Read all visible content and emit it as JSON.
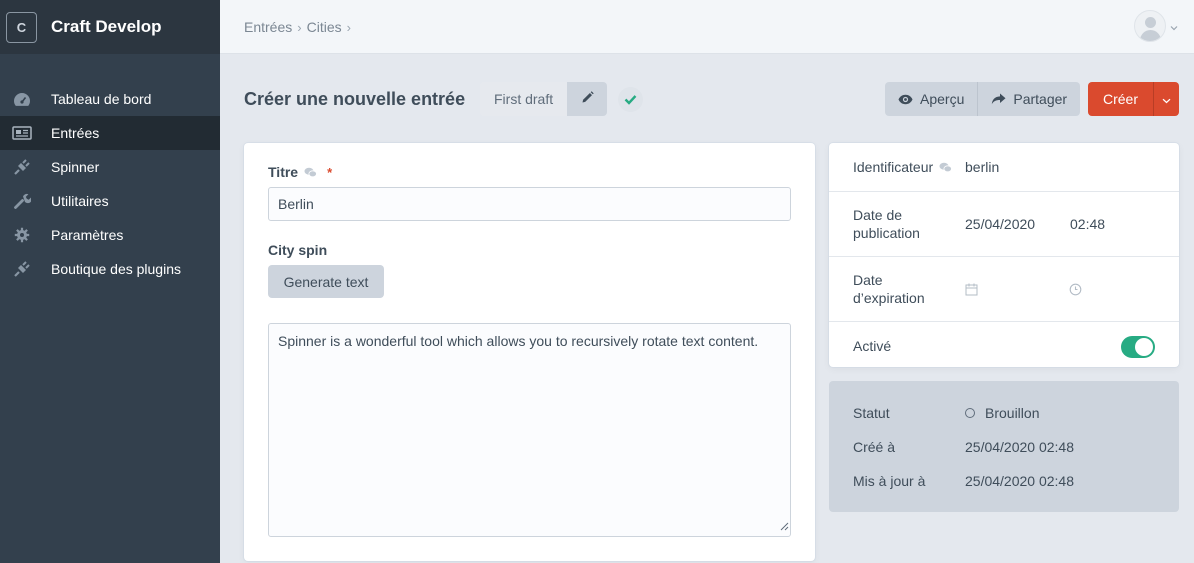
{
  "app": {
    "site_name": "Craft Develop",
    "logo_letter": "C"
  },
  "sidebar": {
    "items": [
      {
        "label": "Tableau de bord",
        "icon": "gauge-icon",
        "active": false
      },
      {
        "label": "Entrées",
        "icon": "newspaper-icon",
        "active": true
      },
      {
        "label": "Spinner",
        "icon": "plug-icon",
        "active": false
      },
      {
        "label": "Utilitaires",
        "icon": "wrench-icon",
        "active": false
      },
      {
        "label": "Paramètres",
        "icon": "gear-icon",
        "active": false
      },
      {
        "label": "Boutique des plugins",
        "icon": "plug-icon",
        "active": false
      }
    ]
  },
  "breadcrumb": [
    "Entrées",
    "Cities"
  ],
  "breadcrumb_separator": "›",
  "toolbar": {
    "title": "Créer une nouvelle entrée",
    "draft_name": "First draft",
    "preview_label": "Aperçu",
    "share_label": "Partager",
    "create_label": "Créer"
  },
  "form": {
    "title_label": "Titre",
    "required_mark": "*",
    "title_value": "Berlin",
    "spin_label": "City spin",
    "generate_label": "Generate text",
    "textarea_value": "Spinner is a wonderful tool which allows you to recursively rotate text content."
  },
  "meta": {
    "slug_label": "Identificateur",
    "slug_value": "berlin",
    "post_date_label": "Date de publication",
    "post_date": "25/04/2020",
    "post_time": "02:48",
    "expiry_label": "Date d’expiration",
    "enabled_label": "Activé",
    "enabled": true
  },
  "status": {
    "status_label": "Statut",
    "status_value": "Brouillon",
    "created_label": "Créé à",
    "created_value": "25/04/2020 02:48",
    "updated_label": "Mis à jour à",
    "updated_value": "25/04/2020 02:48"
  },
  "colors": {
    "sidebar_bg": "#33404d",
    "accent_red": "#da4a2e",
    "toggle_green": "#27ab83"
  }
}
